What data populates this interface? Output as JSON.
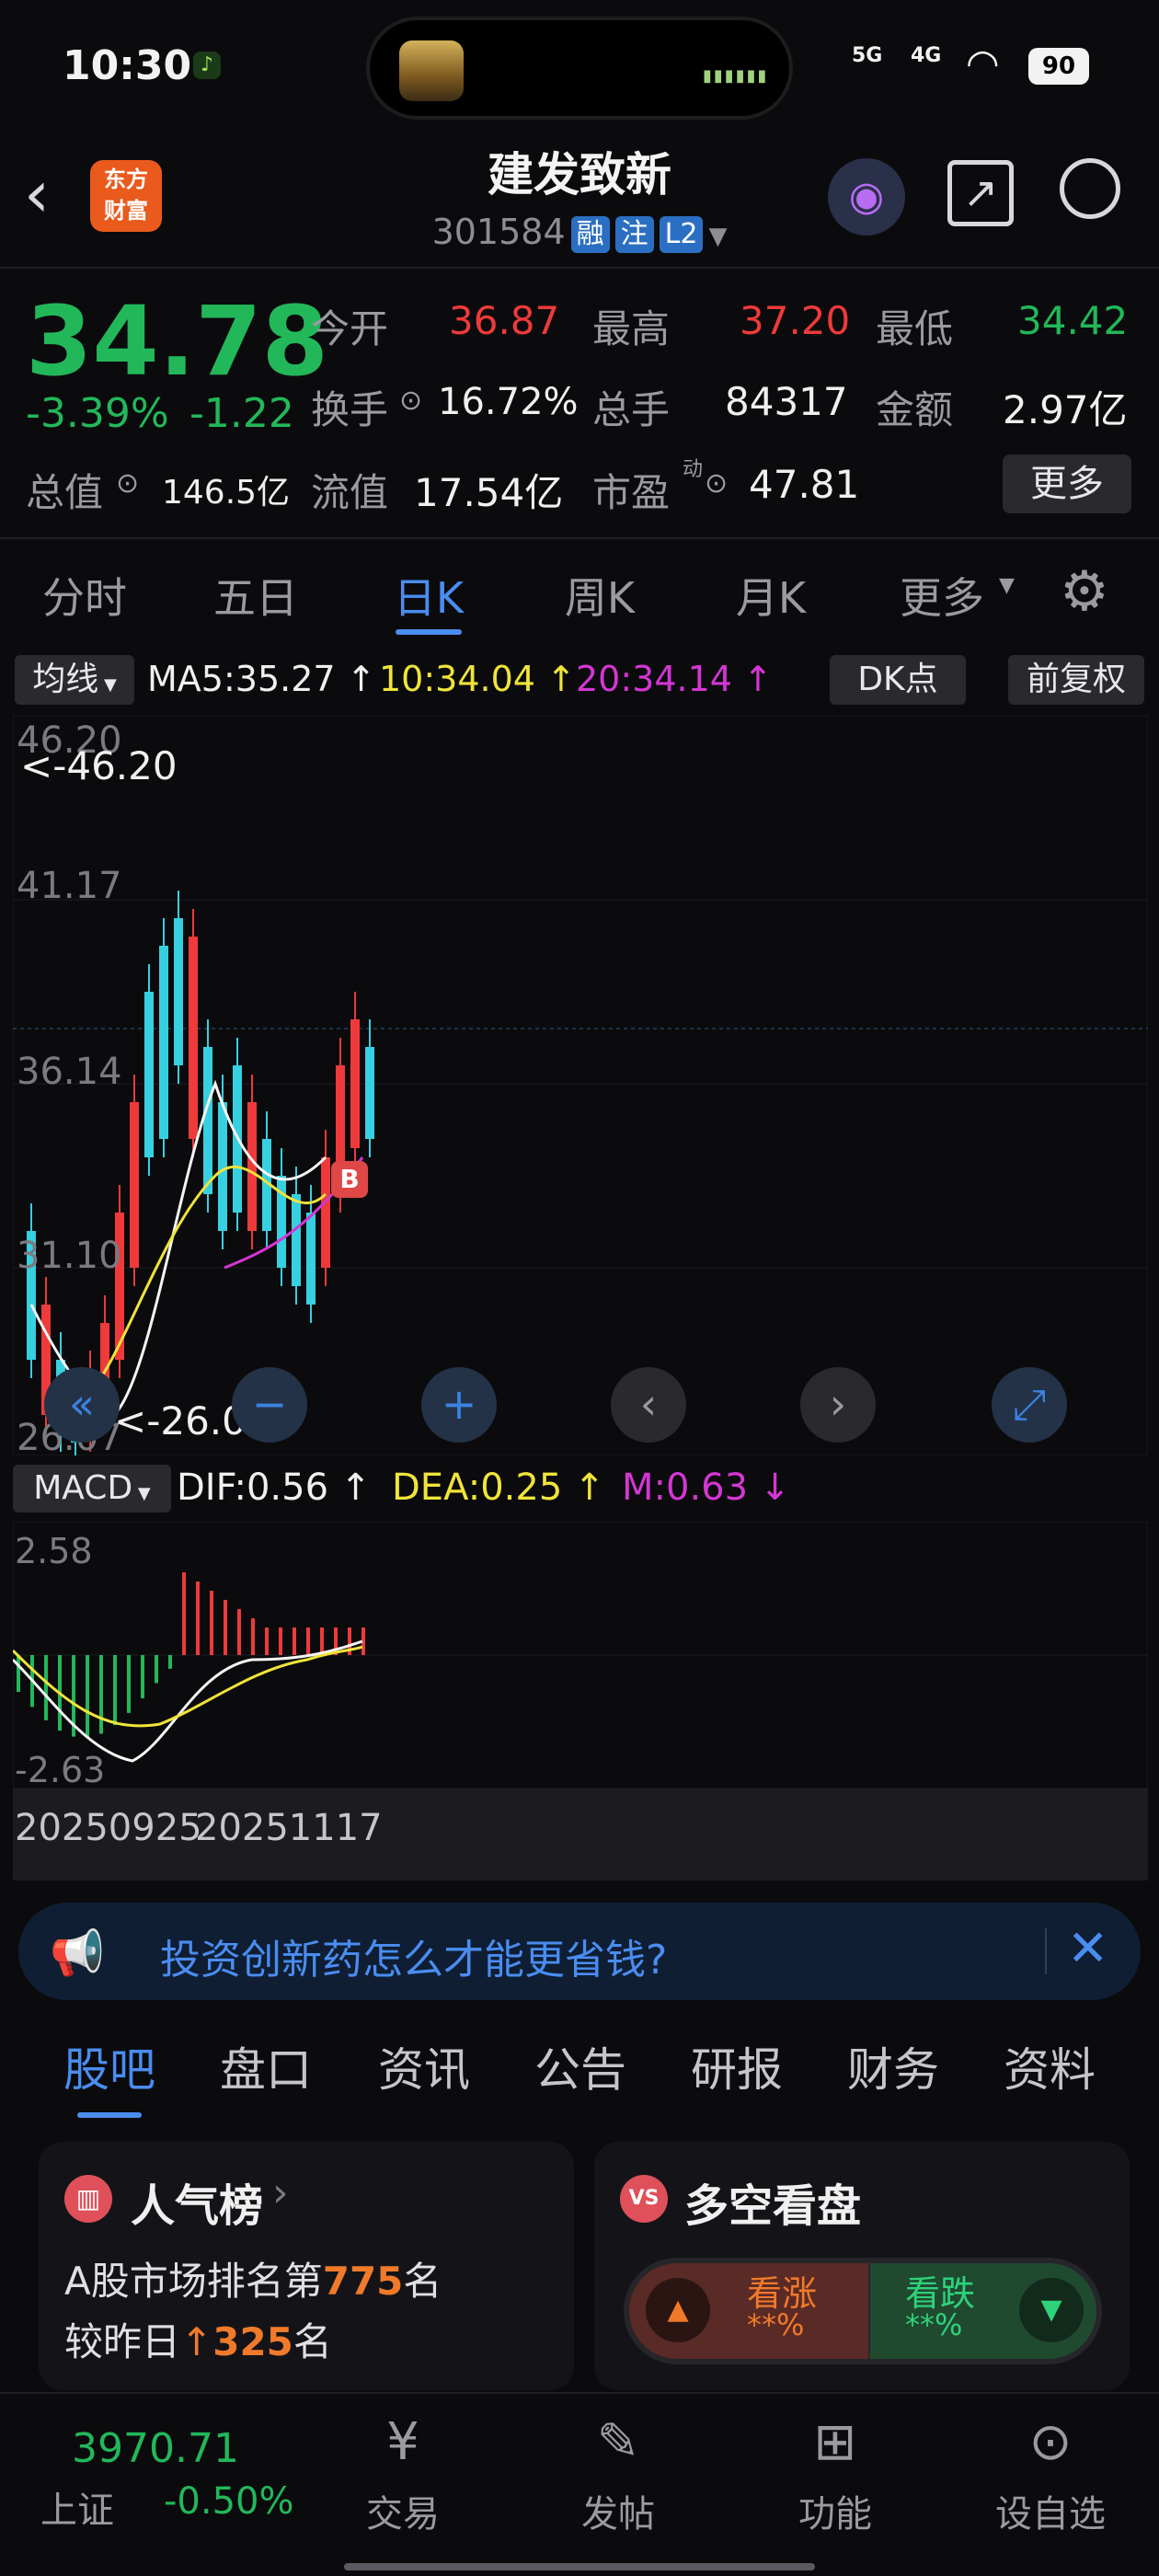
{
  "status": {
    "time": "10:30",
    "signal_5g": "5G",
    "signal_4g": "4G",
    "battery": "90"
  },
  "header": {
    "title": "建发致新",
    "code": "301584",
    "tags": [
      "融",
      "注",
      "L2"
    ],
    "logo_line1": "东方",
    "logo_line2": "财富"
  },
  "quote": {
    "price": "34.78",
    "pct": "-3.39%",
    "change": "-1.22",
    "items": [
      {
        "label": "今开",
        "value": "36.87"
      },
      {
        "label": "最高",
        "value": "37.20"
      },
      {
        "label": "最低",
        "value": "34.42"
      },
      {
        "label": "换手",
        "value": "16.72%"
      },
      {
        "label": "总手",
        "value": "84317"
      },
      {
        "label": "金额",
        "value": "2.97亿"
      },
      {
        "label": "总值",
        "value": "146.5亿"
      },
      {
        "label": "流值",
        "value": "17.54亿"
      },
      {
        "label": "市盈",
        "value": "47.81"
      }
    ],
    "pe_sup": "动",
    "more": "更多"
  },
  "tabs": [
    "分时",
    "五日",
    "日K",
    "周K",
    "月K",
    "更多"
  ],
  "active_tab": "日K",
  "ma": {
    "label": "均线",
    "ma5": "MA5:35.27 ↑",
    "ma10": "10:34.04 ↑",
    "ma20": "20:34.14 ↑",
    "dk": "DK点",
    "fq": "前复权"
  },
  "price_axis": [
    "46.20",
    "41.17",
    "36.14",
    "31.10",
    "26.07"
  ],
  "hi_label": "<-46.20",
  "lo_label": "<-26.07",
  "buy_marker": "B",
  "macd": {
    "label": "MACD",
    "dif": "DIF:0.56 ↑",
    "dea": "DEA:0.25 ↑",
    "m": "M:0.63 ↓",
    "top": "2.58",
    "bottom": "-2.63"
  },
  "dates": [
    "20250925",
    "20251117"
  ],
  "banner": {
    "text": "投资创新药怎么才能更省钱?"
  },
  "tabs2": [
    "股吧",
    "盘口",
    "资讯",
    "公告",
    "研报",
    "财务",
    "资料"
  ],
  "active_tab2": "股吧",
  "card1": {
    "title": "人气榜",
    "line1a": "A股市场排名第",
    "rank": "775",
    "line1b": "名",
    "line2a": "较昨日",
    "delta": "325",
    "line2b": "名"
  },
  "card2": {
    "title": "多空看盘",
    "up": "看涨",
    "down": "看跌",
    "up_pct": "**%",
    "down_pct": "**%"
  },
  "bottom": {
    "index_value": "3970.71",
    "index_name": "上证",
    "index_pct": "-0.50%",
    "items": [
      "交易",
      "发帖",
      "功能",
      "设自选"
    ]
  },
  "colors": {
    "up": "#ee3a3a",
    "down": "#22b85a",
    "accent": "#4a8df0"
  },
  "chart_data": {
    "type": "candlestick",
    "ylim": [
      26.07,
      46.2
    ],
    "ma5": 35.27,
    "ma10": 34.04,
    "ma20": 34.14
  }
}
